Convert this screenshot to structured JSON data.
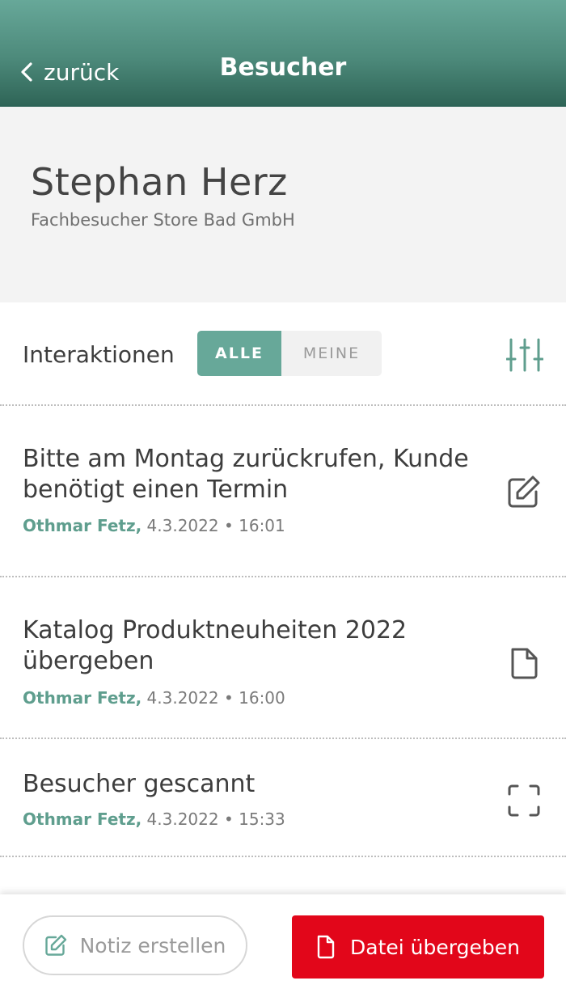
{
  "header": {
    "back_label": "zurück",
    "title": "Besucher"
  },
  "profile": {
    "name": "Stephan Herz",
    "company": "Fachbesucher Store Bad GmbH"
  },
  "interactions": {
    "label": "Interaktionen",
    "filter_options": [
      "ALLE",
      "MEINE"
    ],
    "selected_filter": "ALLE",
    "filter_icon": "sliders-icon"
  },
  "items": [
    {
      "title": "Bitte am Montag zurückrufen, Kunde benötigt einen Termin",
      "author": "Othmar Fetz,",
      "date": "4.3.2022 • 16:01",
      "icon": "edit-note-icon"
    },
    {
      "title": "Katalog Produktneuheiten 2022 übergeben",
      "author": "Othmar Fetz,",
      "date": "4.3.2022 • 16:00",
      "icon": "document-icon"
    },
    {
      "title": "Besucher gescannt",
      "author": "Othmar Fetz,",
      "date": "4.3.2022 • 15:33",
      "icon": "scan-icon"
    }
  ],
  "actions": {
    "note_label": "Notiz erstellen",
    "file_label": "Datei übergeben"
  },
  "colors": {
    "accent": "#67a899",
    "header_dark": "#2f6557",
    "primary_button": "#e2061a",
    "author_text": "#5f9e8e"
  }
}
